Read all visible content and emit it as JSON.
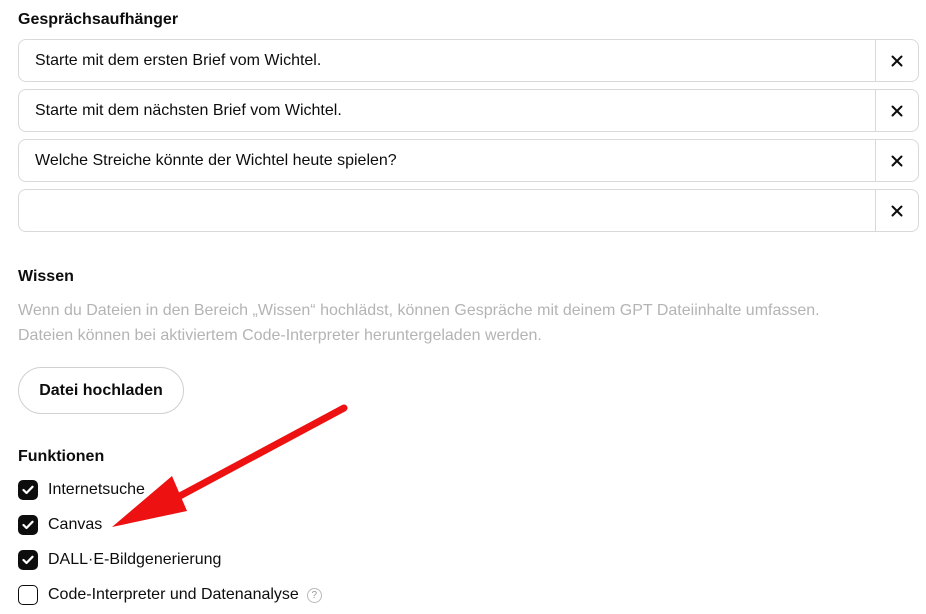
{
  "starters": {
    "title": "Gesprächsaufhänger",
    "items": [
      {
        "value": "Starte mit dem ersten Brief vom Wichtel."
      },
      {
        "value": "Starte mit dem nächsten Brief vom Wichtel."
      },
      {
        "value": "Welche Streiche könnte der Wichtel heute spielen?"
      },
      {
        "value": ""
      }
    ],
    "remove_icon": "close-icon"
  },
  "knowledge": {
    "title": "Wissen",
    "description_line1": "Wenn du Dateien in den Bereich „Wissen“ hochlädst, können Gespräche mit deinem GPT Dateiinhalte umfassen.",
    "description_line2": "Dateien können bei aktiviertem Code-Interpreter heruntergeladen werden.",
    "upload_label": "Datei hochladen"
  },
  "capabilities": {
    "title": "Funktionen",
    "items": [
      {
        "label": "Internetsuche",
        "checked": true
      },
      {
        "label": "Canvas",
        "checked": true
      },
      {
        "label": "DALL·E-Bildgenerierung",
        "checked": true
      },
      {
        "label": "Code-Interpreter und Datenanalyse",
        "checked": false,
        "help_icon": "question-icon",
        "help_text": "?"
      }
    ]
  },
  "annotation": {
    "arrow_color": "#ee1111",
    "target": "Canvas"
  }
}
